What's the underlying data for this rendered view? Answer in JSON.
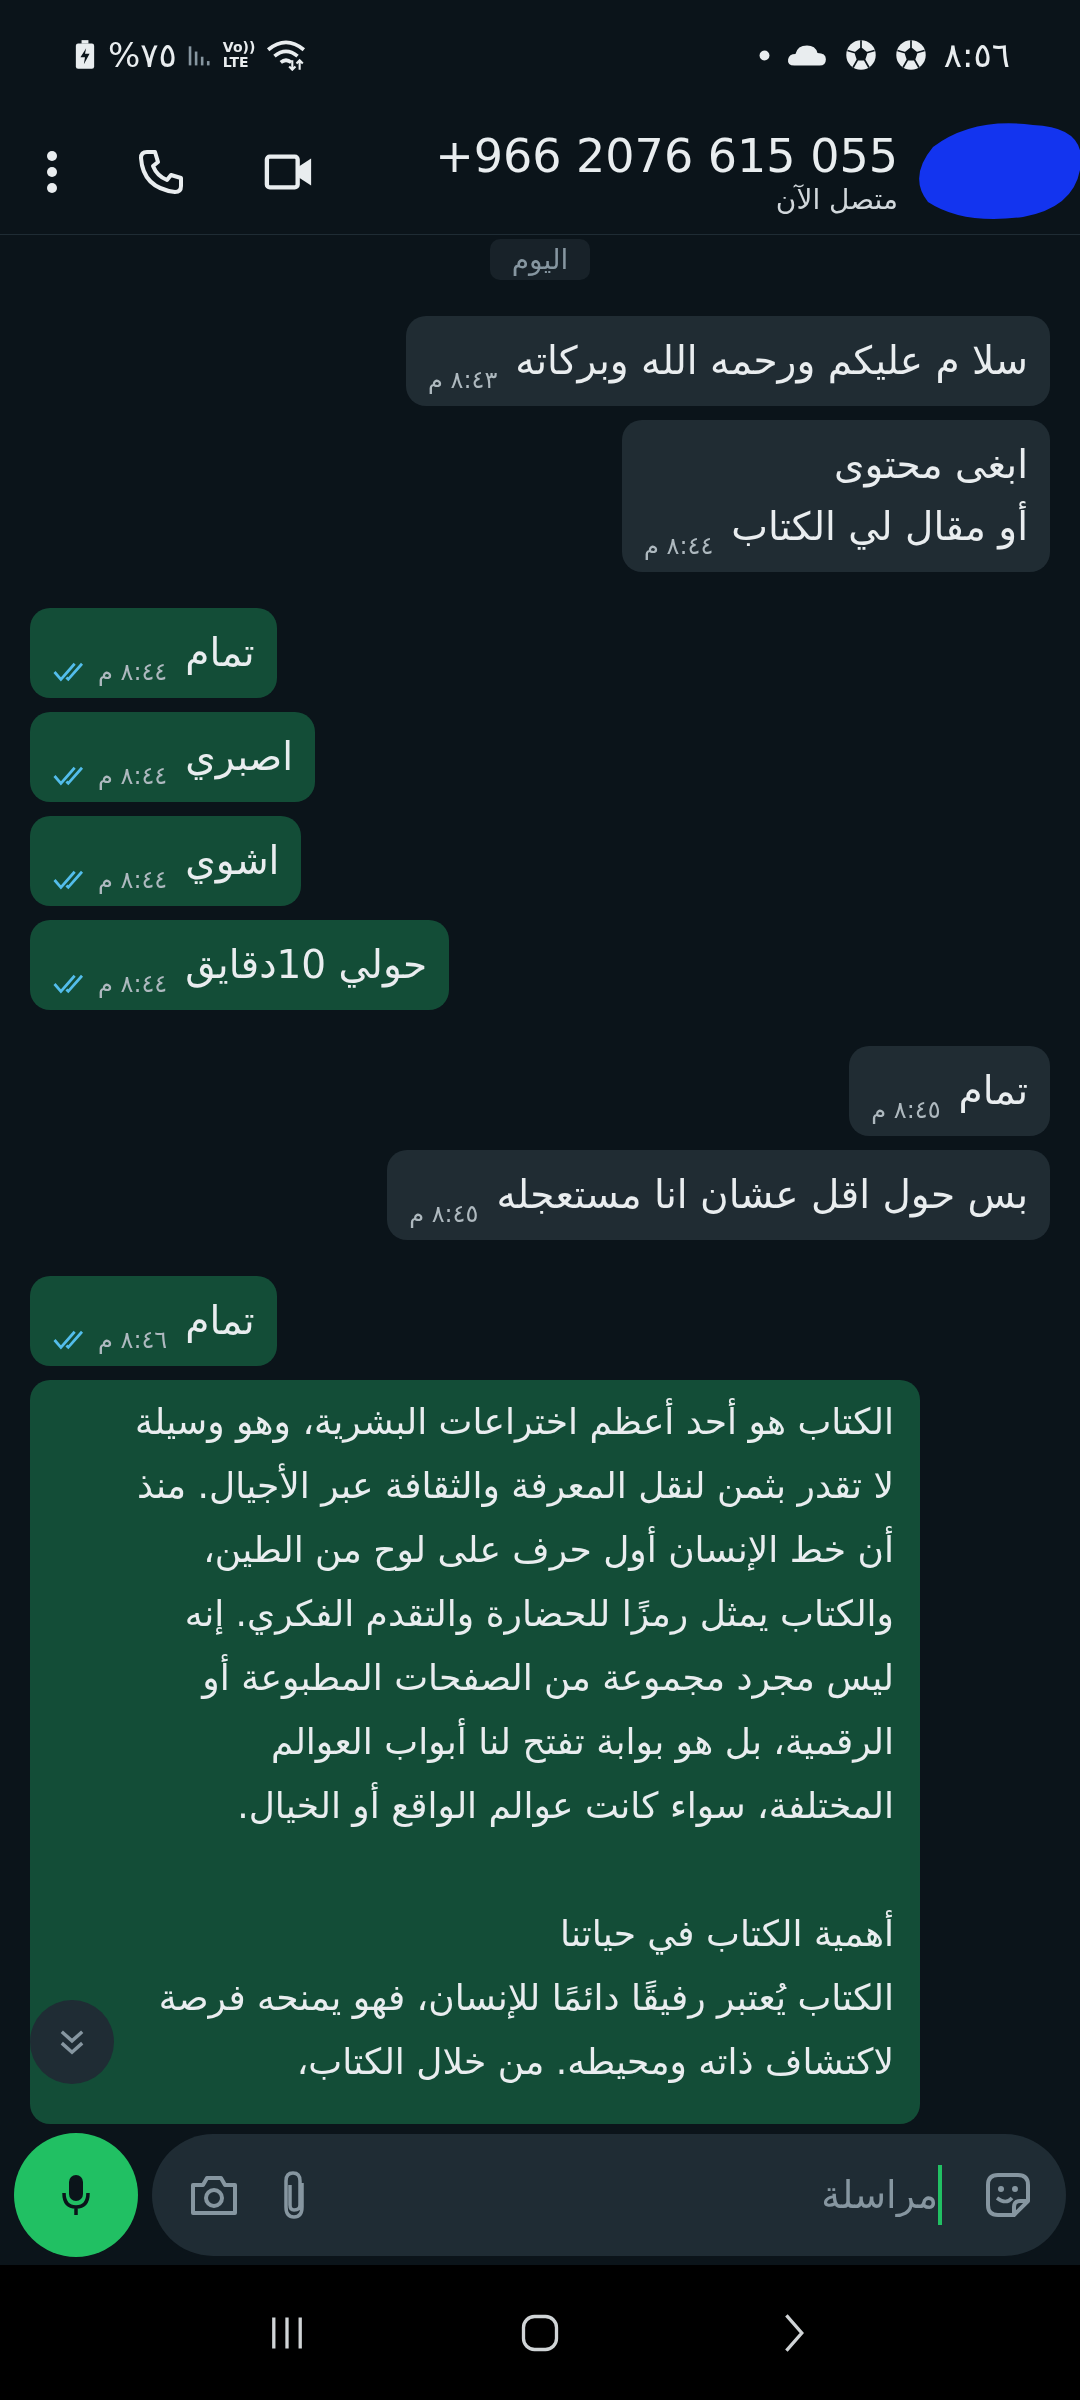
{
  "status_bar": {
    "time": "٨:٥٦",
    "battery": "%٧٥",
    "network_top": "Vo))",
    "network_bottom": "LTE"
  },
  "header": {
    "name": "+966 2076 615 055",
    "status": "متصل الآن"
  },
  "date_chip": "اليوم",
  "messages": [
    {
      "kind": "incoming",
      "text": "سلا م عليكم ورحمه الله وبركاته",
      "time": "٨:٤٣ م"
    },
    {
      "kind": "incoming",
      "text": "ابغى محتوى\nأو مقال لي الكتاب",
      "time": "٨:٤٤ م"
    },
    {
      "kind": "outgoing",
      "text": "تمام",
      "time": "٨:٤٤ م",
      "read": true
    },
    {
      "kind": "outgoing",
      "text": "اصبري",
      "time": "٨:٤٤ م",
      "read": true
    },
    {
      "kind": "outgoing",
      "text": "اشوي",
      "time": "٨:٤٤ م",
      "read": true
    },
    {
      "kind": "outgoing",
      "text": "حولي 10دقايق",
      "time": "٨:٤٤ م",
      "read": true
    },
    {
      "kind": "incoming",
      "text": "تمام",
      "time": "٨:٤٥ م"
    },
    {
      "kind": "incoming",
      "text": "بس حول اقل عشان انا مستعجله",
      "time": "٨:٤٥ م"
    },
    {
      "kind": "outgoing",
      "text": "تمام",
      "time": "٨:٤٦ م",
      "read": true
    },
    {
      "kind": "outgoing",
      "text": "الكتاب هو أحد أعظم اختراعات البشرية، وهو وسيلة لا تقدر بثمن لنقل المعرفة والثقافة عبر الأجيال. منذ أن خط الإنسان أول حرف على لوح من الطين، والكتاب يمثل رمزًا للحضارة والتقدم الفكري. إنه ليس مجرد مجموعة من الصفحات المطبوعة أو الرقمية، بل هو بوابة تفتح لنا أبواب العوالم المختلفة، سواء كانت عوالم الواقع أو الخيال.\n\nأهمية الكتاب في حياتنا\nالكتاب يُعتبر رفيقًا دائمًا للإنسان، فهو يمنحه فرصة لاكتشاف ذاته ومحيطه. من خلال الكتاب،"
    }
  ],
  "composer": {
    "placeholder": "مراسلة"
  }
}
